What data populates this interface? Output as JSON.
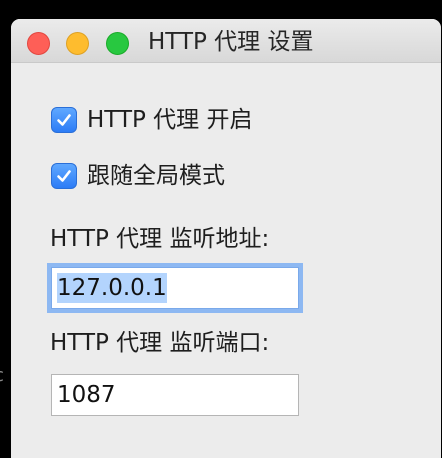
{
  "window": {
    "title": "HTTP 代理 设置"
  },
  "traffic_lights": {
    "close_color": "#fe5f57",
    "minimize_color": "#febc2e",
    "zoom_color": "#28c840"
  },
  "options": [
    {
      "label": "HTTP 代理 开启",
      "checked": true
    },
    {
      "label": "跟随全局模式",
      "checked": true
    }
  ],
  "fields": {
    "address": {
      "label": "HTTP 代理 监听地址:",
      "value": "127.0.0.1",
      "focused": true,
      "text_selected": true
    },
    "port": {
      "label": "HTTP 代理 监听端口:",
      "value": "1087"
    }
  },
  "background": {
    "glyph": "c"
  },
  "accent_color": "#2c7cf6"
}
